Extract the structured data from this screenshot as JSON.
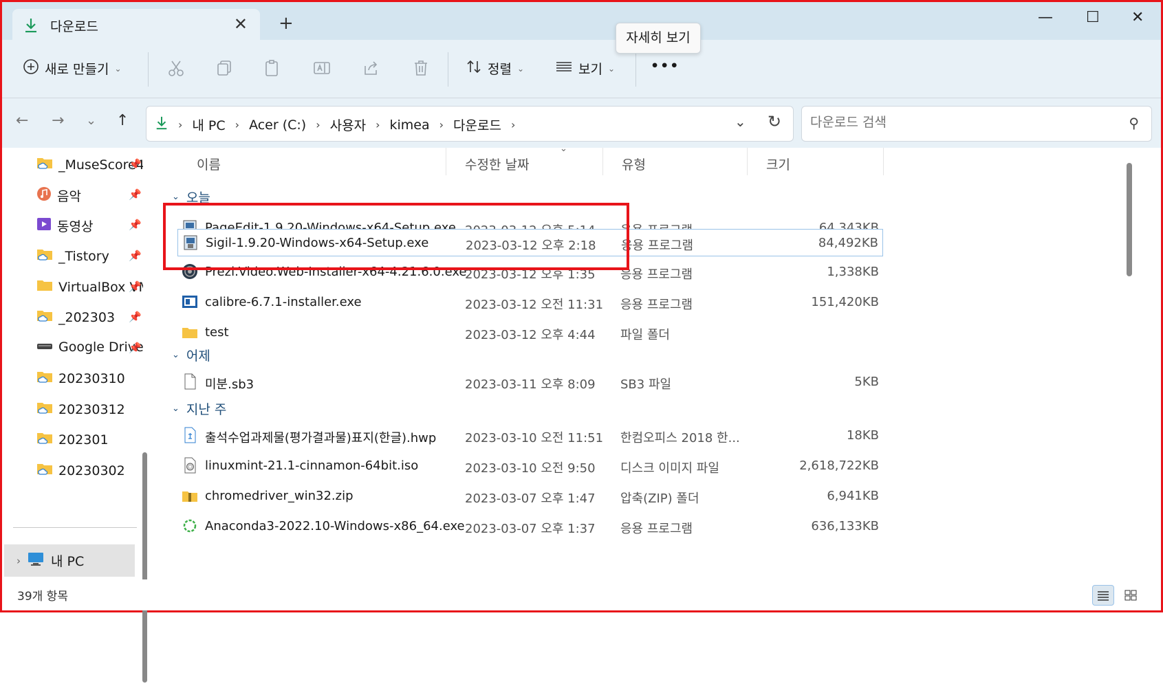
{
  "window": {
    "tab_title": "다운로드",
    "close_tab": "✕",
    "new_tab": "+",
    "minimize": "—",
    "maximize": "☐",
    "close": "✕"
  },
  "toolbar": {
    "new_label": "새로 만들기",
    "sort_label": "정렬",
    "view_label": "보기",
    "more_label": "•••",
    "tooltip": "자세히 보기"
  },
  "address": {
    "crumbs": [
      "내 PC",
      "Acer (C:)",
      "사용자",
      "kimea",
      "다운로드"
    ],
    "search_placeholder": "다운로드 검색"
  },
  "sidebar": {
    "items": [
      {
        "label": "_MuseScore4",
        "icon": "cloud-folder-icon"
      },
      {
        "label": "음악",
        "icon": "music-icon"
      },
      {
        "label": "동영상",
        "icon": "video-icon"
      },
      {
        "label": "_Tistory",
        "icon": "cloud-folder-icon"
      },
      {
        "label": "VirtualBox VM",
        "icon": "folder-icon"
      },
      {
        "label": "_202303",
        "icon": "cloud-folder-icon"
      },
      {
        "label": "Google Drive",
        "icon": "drive-icon"
      },
      {
        "label": "20230310",
        "icon": "cloud-folder-icon"
      },
      {
        "label": "20230312",
        "icon": "cloud-folder-icon"
      },
      {
        "label": "202301",
        "icon": "cloud-folder-icon"
      },
      {
        "label": "20230302",
        "icon": "cloud-folder-icon"
      }
    ],
    "this_pc": "내 PC"
  },
  "columns": {
    "name": "이름",
    "date": "수정한 날짜",
    "type": "유형",
    "size": "크기"
  },
  "groups": {
    "today": "오늘",
    "yesterday": "어제",
    "last_week": "지난 주"
  },
  "files": {
    "today": [
      {
        "name": "PageEdit-1.9.20-Windows-x64-Setup.exe",
        "date": "2023-03-12 오후 5:14",
        "type": "응용 프로그램",
        "size": "64,343KB"
      },
      {
        "name": "Sigil-1.9.20-Windows-x64-Setup.exe",
        "date": "2023-03-12 오후 2:18",
        "type": "응용 프로그램",
        "size": "84,492KB"
      },
      {
        "name": "Prezi.Video.Web-Installer-x64-4.21.6.0.exe",
        "date": "2023-03-12 오후 1:35",
        "type": "응용 프로그램",
        "size": "1,338KB"
      },
      {
        "name": "calibre-6.7.1-installer.exe",
        "date": "2023-03-12 오전 11:31",
        "type": "응용 프로그램",
        "size": "151,420KB"
      },
      {
        "name": "test",
        "date": "2023-03-12 오후 4:44",
        "type": "파일 폴더",
        "size": ""
      }
    ],
    "yesterday": [
      {
        "name": "미분.sb3",
        "date": "2023-03-11 오후 8:09",
        "type": "SB3 파일",
        "size": "5KB"
      }
    ],
    "last_week": [
      {
        "name": "출석수업과제물(평가결과물)표지(한글).hwp",
        "date": "2023-03-10 오전 11:51",
        "type": "한컴오피스 2018 한...",
        "size": "18KB"
      },
      {
        "name": "linuxmint-21.1-cinnamon-64bit.iso",
        "date": "2023-03-10 오전 9:50",
        "type": "디스크 이미지 파일",
        "size": "2,618,722KB"
      },
      {
        "name": "chromedriver_win32.zip",
        "date": "2023-03-07 오후 1:47",
        "type": "압축(ZIP) 폴더",
        "size": "6,941KB"
      },
      {
        "name": "Anaconda3-2022.10-Windows-x86_64.exe",
        "date": "2023-03-07 오후 1:37",
        "type": "응용 프로그램",
        "size": "636,133KB"
      }
    ]
  },
  "status": {
    "count": "39개 항목"
  }
}
